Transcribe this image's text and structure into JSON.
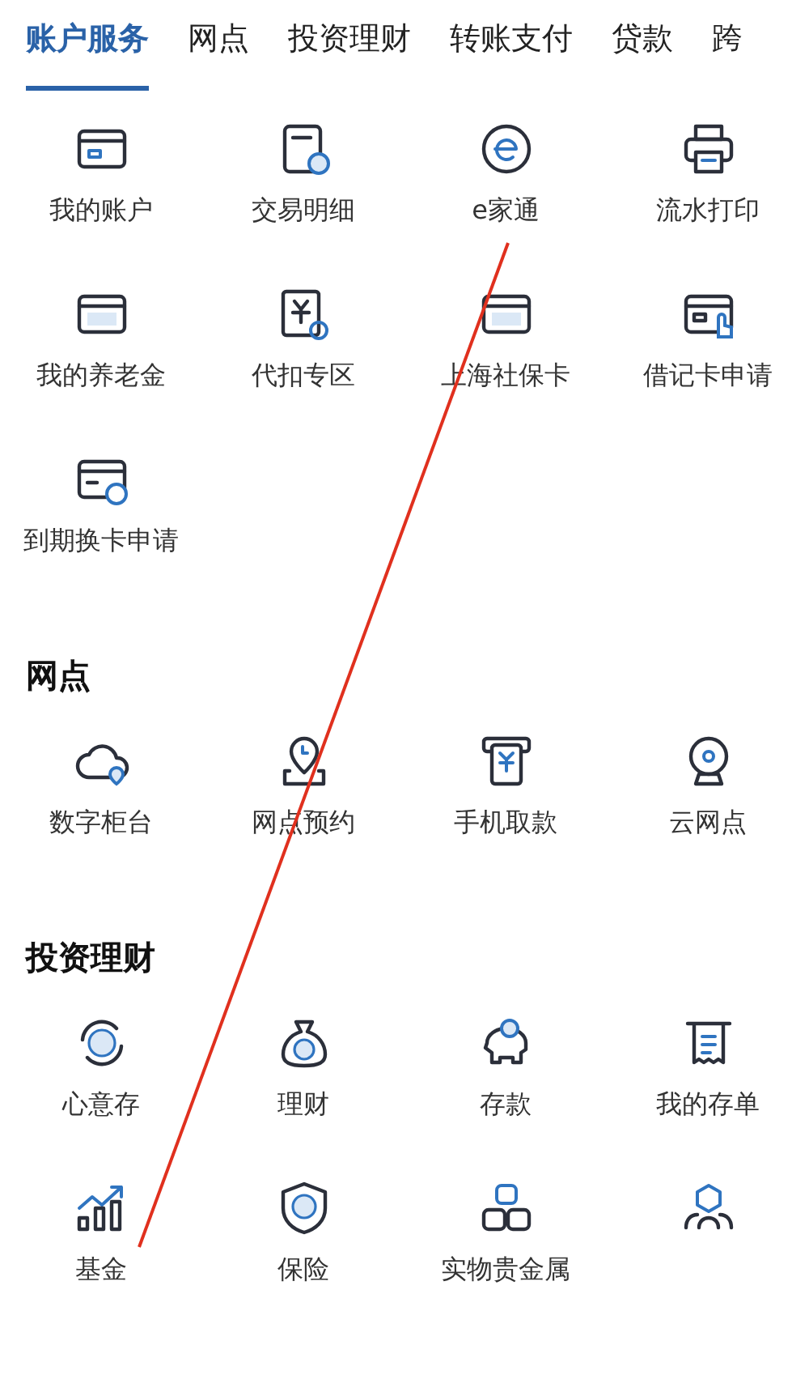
{
  "tabs": [
    {
      "label": "账户服务",
      "selected": true
    },
    {
      "label": "网点",
      "selected": false
    },
    {
      "label": "投资理财",
      "selected": false
    },
    {
      "label": "转账支付",
      "selected": false
    },
    {
      "label": "贷款",
      "selected": false
    },
    {
      "label": "跨",
      "selected": false
    }
  ],
  "sections": [
    {
      "items": [
        {
          "kind": "service",
          "label": "我的账户"
        },
        {
          "kind": "service",
          "label": "交易明细"
        },
        {
          "kind": "service",
          "label": "e家通"
        },
        {
          "kind": "service",
          "label": "流水打印"
        },
        {
          "kind": "service",
          "label": "我的养老金"
        },
        {
          "kind": "service",
          "label": "代扣专区"
        },
        {
          "kind": "service",
          "label": "上海社保卡"
        },
        {
          "kind": "service",
          "label": "借记卡申请"
        },
        {
          "kind": "service",
          "label": "到期换卡申请"
        }
      ]
    },
    {
      "title": "网点",
      "items": [
        {
          "kind": "service",
          "label": "数字柜台"
        },
        {
          "kind": "service",
          "label": "网点预约"
        },
        {
          "kind": "service",
          "label": "手机取款"
        },
        {
          "kind": "service",
          "label": "云网点"
        }
      ]
    },
    {
      "title": "投资理财",
      "items": [
        {
          "kind": "service",
          "label": "心意存"
        },
        {
          "kind": "service",
          "label": "理财"
        },
        {
          "kind": "service",
          "label": "存款"
        },
        {
          "kind": "service",
          "label": "我的存单"
        },
        {
          "kind": "service",
          "label": "基金"
        },
        {
          "kind": "service",
          "label": "保险"
        },
        {
          "kind": "service",
          "label": "实物贵金属"
        },
        {
          "kind": "icon"
        }
      ]
    }
  ]
}
